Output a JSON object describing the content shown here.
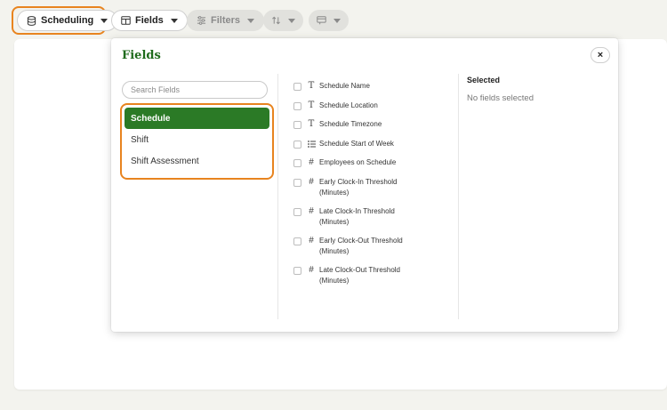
{
  "toolbar": {
    "scheduling_label": "Scheduling",
    "fields_label": "Fields",
    "filters_label": "Filters"
  },
  "popover": {
    "title": "Fields",
    "close_glyph": "×",
    "search_placeholder": "Search Fields",
    "categories": [
      {
        "label": "Schedule",
        "active": true
      },
      {
        "label": "Shift",
        "active": false
      },
      {
        "label": "Shift Assessment",
        "active": false
      }
    ],
    "fields": [
      {
        "label": "Schedule Name",
        "type": "text-icon"
      },
      {
        "label": "Schedule Location",
        "type": "text-icon"
      },
      {
        "label": "Schedule Timezone",
        "type": "text-icon"
      },
      {
        "label": "Schedule Start of Week",
        "type": "list-icon"
      },
      {
        "label": "Employees on Schedule",
        "type": "number-icon"
      },
      {
        "label": "Early Clock-In Threshold (Minutes)",
        "type": "number-icon"
      },
      {
        "label": "Late Clock-In Threshold (Minutes)",
        "type": "number-icon"
      },
      {
        "label": "Early Clock-Out Threshold (Minutes)",
        "type": "number-icon"
      },
      {
        "label": "Late Clock-Out Threshold (Minutes)",
        "type": "number-icon"
      }
    ],
    "selected_title": "Selected",
    "selected_empty": "No fields selected"
  },
  "colors": {
    "accent_green": "#2b7a26",
    "title_green": "#1f6b1c",
    "highlight_orange": "#e8841f"
  }
}
